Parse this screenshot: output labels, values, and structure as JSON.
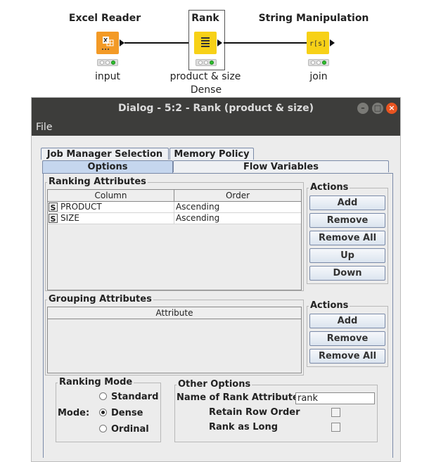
{
  "workflow": {
    "nodes": [
      {
        "title": "Excel Reader",
        "label": "input",
        "label2": ""
      },
      {
        "title": "Rank",
        "label": "product & size",
        "label2": "Dense"
      },
      {
        "title": "String Manipulation",
        "label": "join",
        "label2": ""
      }
    ],
    "string_icon_text": "r[s]"
  },
  "dialog": {
    "title": "Dialog - 5:2 - Rank (product & size)",
    "menu": [
      "File"
    ],
    "tabs_back": [
      "Job Manager Selection",
      "Memory Policy"
    ],
    "tabs_front": [
      "Options",
      "Flow Variables"
    ],
    "ranking": {
      "title": "Ranking Attributes",
      "columns": [
        "Column",
        "Order"
      ],
      "rows": [
        {
          "type": "S",
          "column": "PRODUCT",
          "order": "Ascending"
        },
        {
          "type": "S",
          "column": "SIZE",
          "order": "Ascending"
        }
      ],
      "actions_title": "Actions",
      "actions": [
        "Add",
        "Remove",
        "Remove All",
        "Up",
        "Down"
      ]
    },
    "grouping": {
      "title": "Grouping Attributes",
      "columns": [
        "Attribute"
      ],
      "actions_title": "Actions",
      "actions": [
        "Add",
        "Remove",
        "Remove All"
      ]
    },
    "ranking_mode": {
      "title": "Ranking Mode",
      "mode_label": "Mode:",
      "options": [
        "Standard",
        "Dense",
        "Ordinal"
      ],
      "selected": "Dense"
    },
    "other": {
      "title": "Other Options",
      "rank_name_label": "Name of Rank Attribute",
      "rank_name_value": "rank",
      "retain_label": "Retain Row Order",
      "retain_checked": false,
      "long_label": "Rank as Long",
      "long_checked": false
    }
  }
}
